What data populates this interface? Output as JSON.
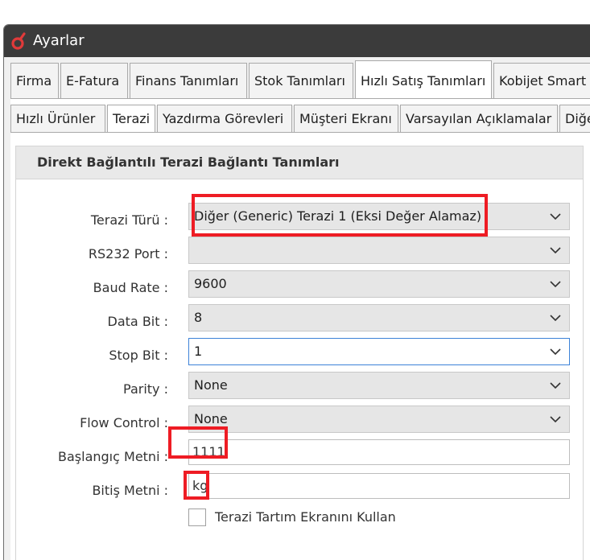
{
  "window": {
    "title": "Ayarlar"
  },
  "main_tabs": [
    {
      "label": "Firma"
    },
    {
      "label": "E-Fatura"
    },
    {
      "label": "Finans Tanımları"
    },
    {
      "label": "Stok Tanımları"
    },
    {
      "label": "Hızlı Satış Tanımları"
    },
    {
      "label": "Kobijet Smart"
    }
  ],
  "main_active": "Hızlı Satış Tanımları",
  "sub_tabs": [
    {
      "label": "Hızlı Ürünler"
    },
    {
      "label": "Terazi"
    },
    {
      "label": "Yazdırma Görevleri"
    },
    {
      "label": "Müşteri Ekranı"
    },
    {
      "label": "Varsayılan Açıklamalar"
    },
    {
      "label": "Diğer"
    }
  ],
  "sub_active": "Terazi",
  "group": {
    "title": "Direkt Bağlantılı Terazi Bağlantı Tanımları"
  },
  "fields": {
    "scale_type": {
      "label": "Terazi Türü :",
      "value": "Diğer (Generic) Terazi 1 (Eksi Değer Alamaz)"
    },
    "rs232_port": {
      "label": "RS232 Port :",
      "value": ""
    },
    "baud_rate": {
      "label": "Baud Rate :",
      "value": "9600"
    },
    "data_bit": {
      "label": "Data Bit :",
      "value": "8"
    },
    "stop_bit": {
      "label": "Stop Bit :",
      "value": "1"
    },
    "parity": {
      "label": "Parity :",
      "value": "None"
    },
    "flow_control": {
      "label": "Flow Control :",
      "value": "None"
    },
    "start_text": {
      "label": "Başlangıç Metni :",
      "value": "1111"
    },
    "end_text": {
      "label": "Bitiş Metni :",
      "value": "kg"
    }
  },
  "use_scale_screen": {
    "label": "Terazi Tartım Ekranını Kullan",
    "checked": false
  },
  "colors": {
    "title_bar": "#3b3b3b",
    "logo": "#e03a3a",
    "highlight": "#ee1c24",
    "focus_border": "#3c82d8"
  }
}
